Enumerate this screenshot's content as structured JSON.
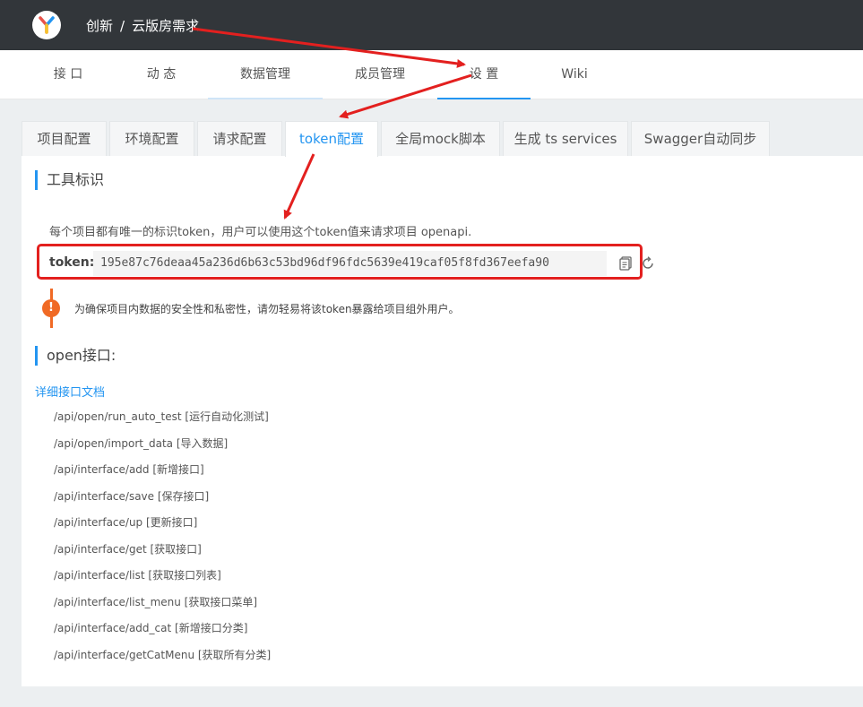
{
  "header": {
    "group": "创新",
    "separator": "/",
    "project": "云版房需求"
  },
  "nav": {
    "items": [
      "接 口",
      "动 态",
      "数据管理",
      "成员管理",
      "设 置",
      "Wiki"
    ]
  },
  "settings_tabs": [
    "项目配置",
    "环境配置",
    "请求配置",
    "token配置",
    "全局mock脚本",
    "生成 ts services",
    "Swagger自动同步"
  ],
  "token_section": {
    "title": "工具标识",
    "description": "每个项目都有唯一的标识token，用户可以使用这个token值来请求项目 openapi.",
    "token_label": "token:",
    "token_value": "195e87c76deaa45a236d6b63c53bd96df96fdc5639e419caf05f8fd367eefa90",
    "warning_text": "为确保项目内数据的安全性和私密性，请勿轻易将该token暴露给项目组外用户。"
  },
  "open_section": {
    "title": "open接口:",
    "doc_link": "详细接口文档",
    "apis": [
      "/api/open/run_auto_test [运行自动化测试]",
      "/api/open/import_data [导入数据]",
      "/api/interface/add [新增接口]",
      "/api/interface/save [保存接口]",
      "/api/interface/up [更新接口]",
      "/api/interface/get [获取接口]",
      "/api/interface/list [获取接口列表]",
      "/api/interface/list_menu [获取接口菜单]",
      "/api/interface/add_cat [新增接口分类]",
      "/api/interface/getCatMenu [获取所有分类]"
    ]
  },
  "colors": {
    "accent": "#2395f1",
    "annotation": "#e3201f",
    "warning": "#f06a25",
    "topbar": "#32363a"
  }
}
